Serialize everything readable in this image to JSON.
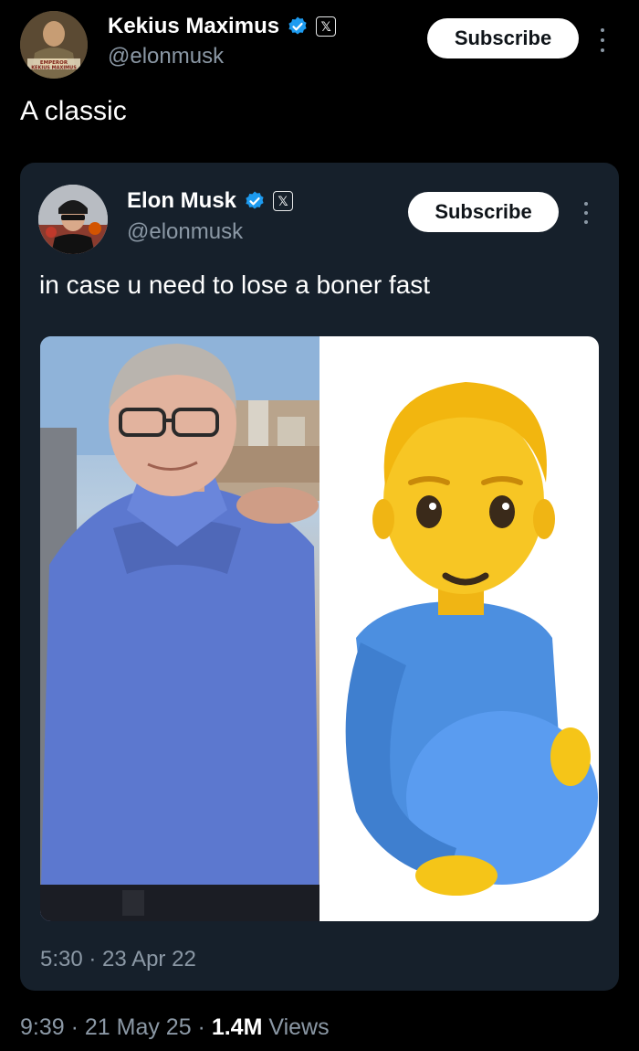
{
  "post": {
    "author": {
      "display_name": "Kekius Maximus",
      "handle": "@elonmusk",
      "avatar_caption": "EMPEROR KEKIUS MAXIMUS"
    },
    "subscribe_label": "Subscribe",
    "text": "A classic",
    "timestamp": "9:39 · 21 May 25 · ",
    "views_count": "1.4M",
    "views_label": " Views"
  },
  "quoted_post": {
    "author": {
      "display_name": "Elon Musk",
      "handle": "@elonmusk"
    },
    "subscribe_label": "Subscribe",
    "text": "in case u need to lose a boner fast",
    "timestamp": "5:30 · 23 Apr 22",
    "media": {
      "left_image": "photo-man-blue-polo",
      "right_image": "pregnant-man-emoji"
    }
  },
  "icons": {
    "verified": "verified-badge-icon",
    "x_logo": "x-logo-icon",
    "more": "more-options-icon"
  },
  "colors": {
    "background": "#000000",
    "card": "#16202b",
    "text_primary": "#ffffff",
    "text_secondary": "#8b98a5",
    "verified_blue": "#1d9bf0",
    "button_bg": "#ffffff"
  }
}
